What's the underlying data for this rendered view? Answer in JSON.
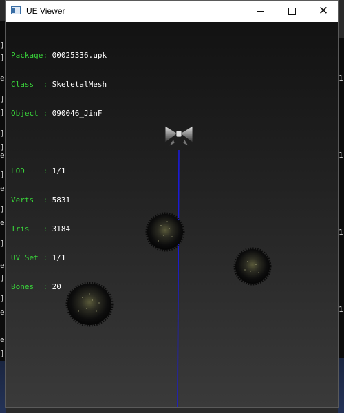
{
  "window": {
    "title": "UE Viewer"
  },
  "info": {
    "package": {
      "key": "Package: ",
      "value": "00025336.upk"
    },
    "class": {
      "key": "Class  : ",
      "value": "SkeletalMesh"
    },
    "object": {
      "key": "Object : ",
      "value": "090046_JinF"
    },
    "lod": {
      "key": "LOD    : ",
      "value": "1/1"
    },
    "verts": {
      "key": "Verts  : ",
      "value": "5831"
    },
    "tris": {
      "key": "Tris   : ",
      "value": "3184"
    },
    "uvset": {
      "key": "UV Set : ",
      "value": "1/1"
    },
    "bones": {
      "key": "Bones  : ",
      "value": "20"
    }
  },
  "colors": {
    "label": "#39d43a",
    "value": "#ffffff",
    "bone_line": "#1b1bd6",
    "viewport_top": "#121212",
    "viewport_bottom": "#3a3a3a"
  }
}
